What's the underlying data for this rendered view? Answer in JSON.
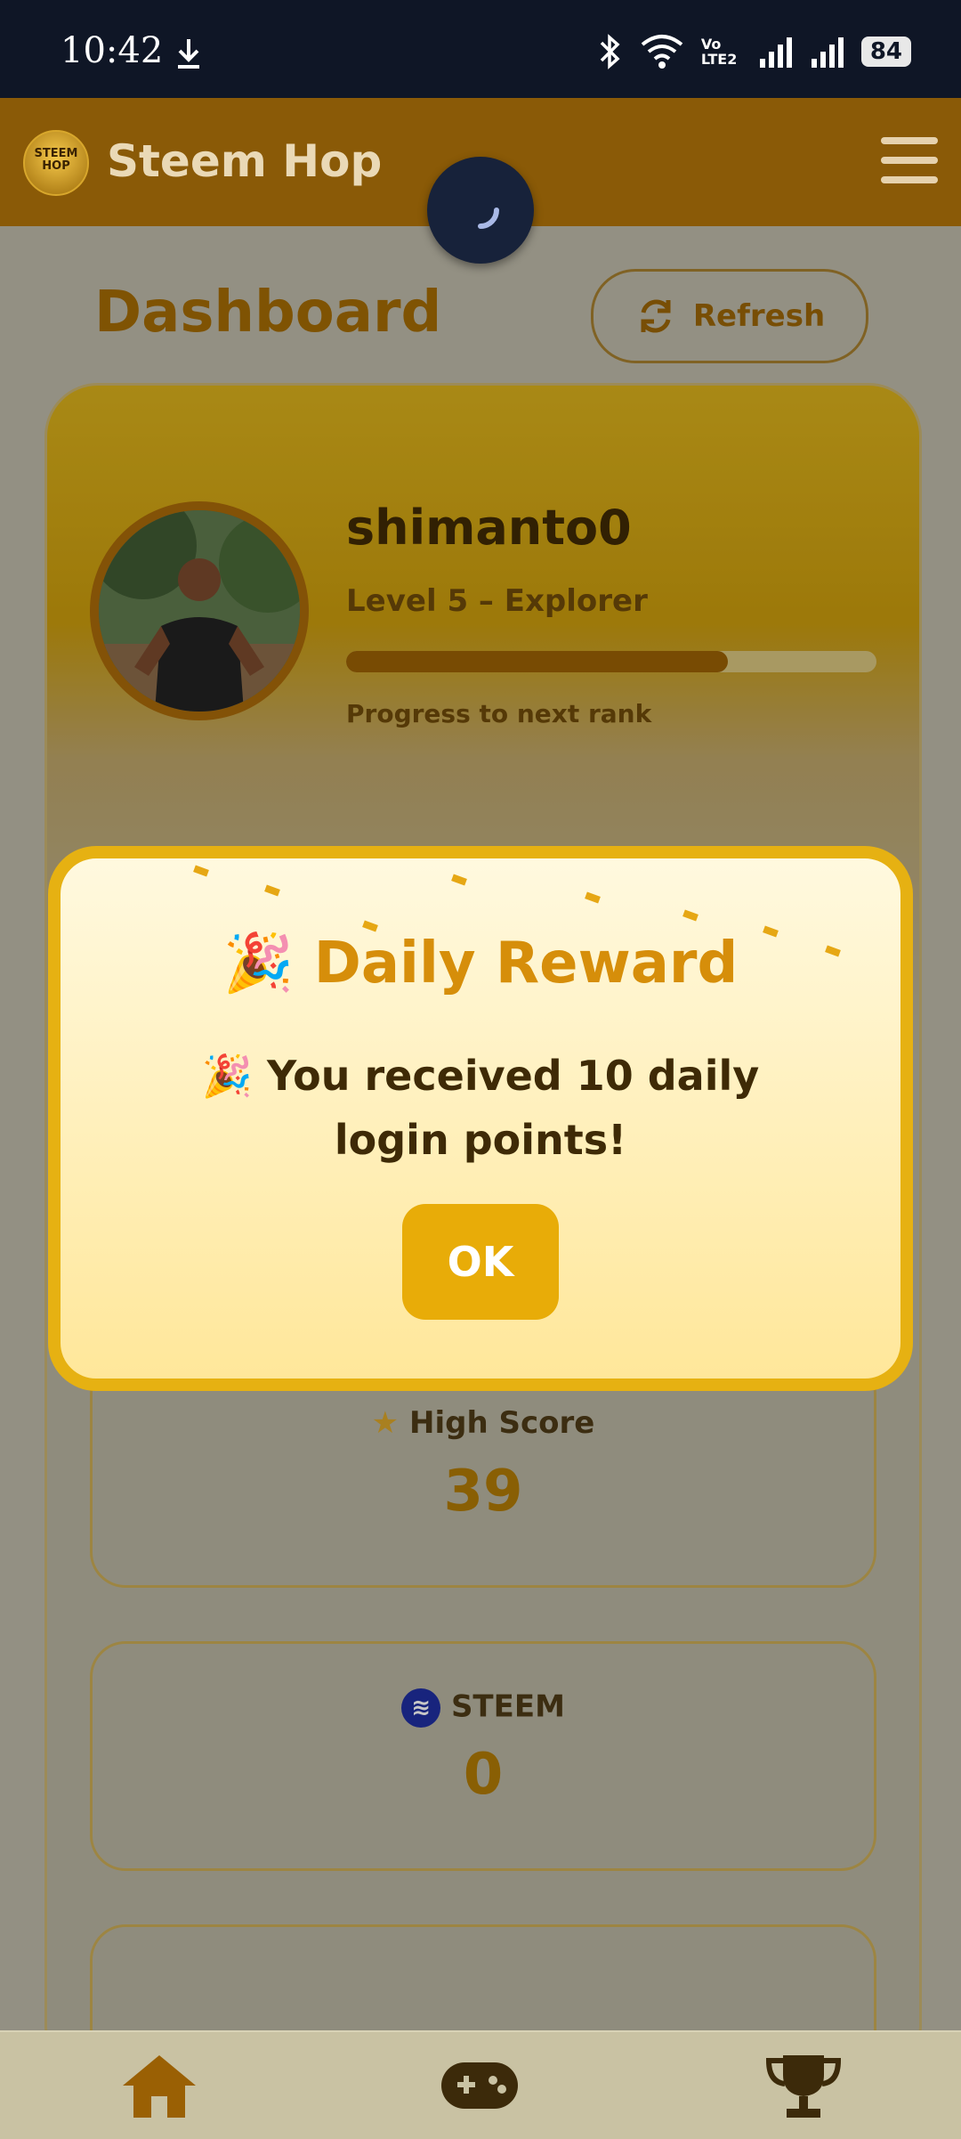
{
  "status_bar": {
    "time": "10:42",
    "battery": "84",
    "network": "Vo LTE2"
  },
  "app_bar": {
    "title": "Steem Hop",
    "logo_text": "STEEM HOP"
  },
  "dashboard": {
    "title": "Dashboard",
    "refresh_label": "Refresh",
    "profile": {
      "username": "shimanto0",
      "level": "Level 5 – Explorer",
      "progress_label": "Progress to next rank",
      "progress_fraction": 0.72
    },
    "stats": [
      {
        "label": "High Score",
        "value": "39",
        "icon": "star-icon"
      },
      {
        "label": "STEEM",
        "value": "0",
        "icon": "steem-icon"
      }
    ]
  },
  "modal": {
    "title": "Daily Reward",
    "message": "You received 10 daily login points!",
    "ok_label": "OK",
    "emoji": "🎉"
  },
  "bottom_nav": {
    "items": [
      "home-icon",
      "gamepad-icon",
      "trophy-icon"
    ]
  },
  "colors": {
    "accent": "#e8ac08",
    "appbar": "#8a5a07",
    "status_bar": "#0f1626"
  }
}
